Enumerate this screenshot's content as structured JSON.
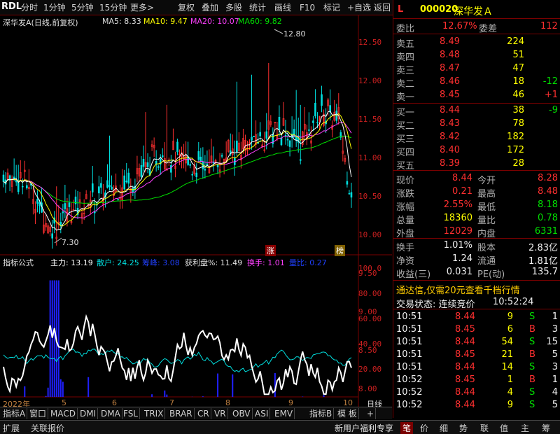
{
  "toolbar": {
    "logo": "RDL",
    "items": [
      "分时",
      "1分钟",
      "5分钟",
      "15分钟",
      "更多>",
      "复权",
      "叠加",
      "多股",
      "统计",
      "画线",
      "F10",
      "标记",
      "+自选",
      "返回"
    ]
  },
  "chart_header": {
    "name": "深华发A(日线,前复权)",
    "ma5": "MA5: 8.33",
    "ma10": "MA10: 9.47",
    "ma20": "MA20: 10.07",
    "ma60": "MA60: 9.82"
  },
  "price_axis": [
    "12.50",
    "12.00",
    "11.50",
    "11.00",
    "10.50",
    "10.00",
    "9.50",
    "9.00",
    "8.50",
    "8.00"
  ],
  "annotations": {
    "high": "12.80",
    "low": "7.30",
    "tag1": "涨",
    "tag2": "榜"
  },
  "indicator_header": {
    "title": "指标公式",
    "zl": "主力: 13.19",
    "sh": "散户: 24.25",
    "ws": "筹峰: 3.08",
    "hl": "获利盘%: 11.49",
    "hs": "换手: 1.01",
    "lb": "量比: 0.27"
  },
  "indicator_axis": [
    "100.0",
    "80.00",
    "60.00",
    "40.00",
    "20.00"
  ],
  "date_axis": [
    "2022年",
    "5",
    "6",
    "7",
    "8",
    "9",
    "10"
  ],
  "period": "日线",
  "tabs": [
    "指标A",
    "窗口",
    "MACD",
    "DMI",
    "DMA",
    "FSL",
    "TRIX",
    "BRAR",
    "CR",
    "VR",
    "OBV",
    "ASI",
    "EMV",
    "指标B",
    "模 板",
    "+"
  ],
  "status_bar": {
    "left": [
      "扩展",
      "关联报价"
    ],
    "promo": "新用户福利专享",
    "right": [
      "笔",
      "价",
      "细",
      "势",
      "联",
      "值",
      "主",
      "筹"
    ]
  },
  "stock": {
    "flag": "L",
    "code": "000020",
    "name": "深华发Ａ"
  },
  "weibi": {
    "l1": "委比",
    "v1": "12.67%",
    "l2": "委差",
    "v2": "112"
  },
  "asks": [
    {
      "l": "卖五",
      "p": "8.49",
      "v": "224",
      "c": ""
    },
    {
      "l": "卖四",
      "p": "8.48",
      "v": "51",
      "c": ""
    },
    {
      "l": "卖三",
      "p": "8.47",
      "v": "47",
      "c": ""
    },
    {
      "l": "卖二",
      "p": "8.46",
      "v": "18",
      "c": "-12"
    },
    {
      "l": "卖一",
      "p": "8.45",
      "v": "46",
      "c": "+1"
    }
  ],
  "bids": [
    {
      "l": "买一",
      "p": "8.44",
      "v": "38",
      "c": "-9"
    },
    {
      "l": "买二",
      "p": "8.43",
      "v": "78",
      "c": ""
    },
    {
      "l": "买三",
      "p": "8.42",
      "v": "182",
      "c": ""
    },
    {
      "l": "买四",
      "p": "8.40",
      "v": "172",
      "c": ""
    },
    {
      "l": "买五",
      "p": "8.39",
      "v": "28",
      "c": ""
    }
  ],
  "quote": [
    {
      "l1": "现价",
      "v1": "8.44",
      "c1": "red",
      "l2": "今开",
      "v2": "8.28",
      "c2": "red"
    },
    {
      "l1": "涨跌",
      "v1": "0.21",
      "c1": "red",
      "l2": "最高",
      "v2": "8.48",
      "c2": "red"
    },
    {
      "l1": "涨幅",
      "v1": "2.55%",
      "c1": "red",
      "l2": "最低",
      "v2": "8.18",
      "c2": "grn"
    },
    {
      "l1": "总量",
      "v1": "18360",
      "c1": "yel",
      "l2": "量比",
      "v2": "0.78",
      "c2": "grn"
    },
    {
      "l1": "外盘",
      "v1": "12029",
      "c1": "red",
      "l2": "内盘",
      "v2": "6331",
      "c2": "grn"
    }
  ],
  "quote2": [
    {
      "l1": "换手",
      "v1": "1.01%",
      "l2": "股本",
      "v2": "2.83亿"
    },
    {
      "l1": "净资",
      "v1": "1.24",
      "l2": "流通",
      "v2": "1.81亿"
    },
    {
      "l1": "收益(三)",
      "v1": "0.031",
      "l2": "PE(动)",
      "v2": "135.7"
    }
  ],
  "promo": "通达信,仅需20元查看千档行情",
  "trade_state": {
    "label": "交易状态: 连续竞价",
    "time": "10:52:24"
  },
  "ticks": [
    {
      "t": "10:51",
      "p": "8.44",
      "v": "9",
      "s": "S",
      "n": "1"
    },
    {
      "t": "10:51",
      "p": "8.45",
      "v": "6",
      "s": "B",
      "n": "3"
    },
    {
      "t": "10:51",
      "p": "8.44",
      "v": "54",
      "s": "S",
      "n": "15"
    },
    {
      "t": "10:51",
      "p": "8.45",
      "v": "21",
      "s": "B",
      "n": "5"
    },
    {
      "t": "10:51",
      "p": "8.44",
      "v": "14",
      "s": "S",
      "n": "3"
    },
    {
      "t": "10:52",
      "p": "8.45",
      "v": "1",
      "s": "B",
      "n": "1"
    },
    {
      "t": "10:52",
      "p": "8.44",
      "v": "4",
      "s": "S",
      "n": "4"
    },
    {
      "t": "10:52",
      "p": "8.44",
      "v": "9",
      "s": "S",
      "n": "5"
    }
  ],
  "colors": {
    "up": "#ff3030",
    "down": "#00e000",
    "ma5": "#ffffff",
    "ma10": "#ffff00",
    "ma20": "#ff40ff",
    "ma60": "#00e000",
    "zl": "#ffffff",
    "sh": "#00e0e0",
    "ws": "#2020ff"
  }
}
